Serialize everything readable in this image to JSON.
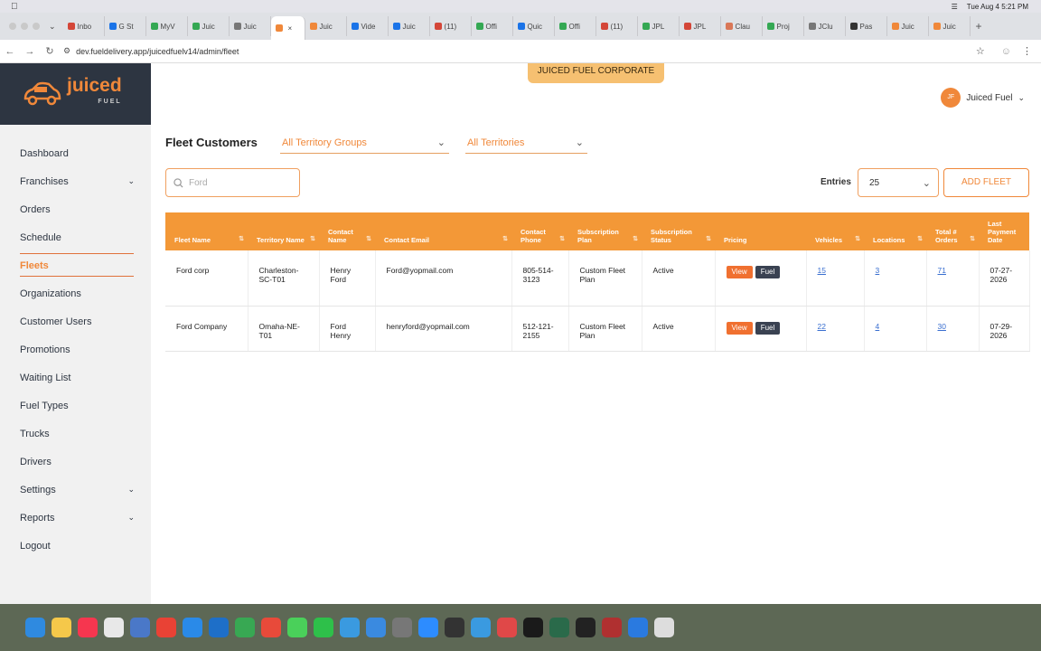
{
  "menubar": {
    "clock": "Tue Aug 4  5:21 PM"
  },
  "browser": {
    "tabs": [
      {
        "label": "Inbo",
        "color": "#d44638"
      },
      {
        "label": "G St",
        "color": "#1a73e8"
      },
      {
        "label": "MyV",
        "color": "#34a853"
      },
      {
        "label": "Juic",
        "color": "#34a853"
      },
      {
        "label": "Juic",
        "color": "#777"
      },
      {
        "label": "",
        "color": "#f0883a",
        "active": true
      },
      {
        "label": "Juic",
        "color": "#f0883a"
      },
      {
        "label": "Vide",
        "color": "#1a73e8"
      },
      {
        "label": "Juic",
        "color": "#1a73e8"
      },
      {
        "label": "(11)",
        "color": "#d44638"
      },
      {
        "label": "Offi",
        "color": "#34a853"
      },
      {
        "label": "Quic",
        "color": "#1a73e8"
      },
      {
        "label": "Offi",
        "color": "#34a853"
      },
      {
        "label": "(11)",
        "color": "#d44638"
      },
      {
        "label": "JPL",
        "color": "#34a853"
      },
      {
        "label": "JPL",
        "color": "#d44638"
      },
      {
        "label": "Clau",
        "color": "#d97757"
      },
      {
        "label": "Proj",
        "color": "#34a853"
      },
      {
        "label": "JClu",
        "color": "#777"
      },
      {
        "label": "Pas",
        "color": "#333"
      },
      {
        "label": "Juic",
        "color": "#f0883a"
      },
      {
        "label": "Juic",
        "color": "#f0883a"
      }
    ],
    "url": "dev.fueldelivery.app/juicedfuelv14/admin/fleet"
  },
  "sidebar": {
    "brand": "juiced",
    "brand_sub": "FUEL",
    "items": [
      {
        "label": "Dashboard",
        "chevron": false
      },
      {
        "label": "Franchises",
        "chevron": true
      },
      {
        "label": "Orders",
        "chevron": false
      },
      {
        "label": "Schedule",
        "chevron": false
      },
      {
        "label": "Fleets",
        "chevron": false,
        "active": true
      },
      {
        "label": "Organizations",
        "chevron": false
      },
      {
        "label": "Customer Users",
        "chevron": false
      },
      {
        "label": "Promotions",
        "chevron": false
      },
      {
        "label": "Waiting List",
        "chevron": false
      },
      {
        "label": "Fuel Types",
        "chevron": false
      },
      {
        "label": "Trucks",
        "chevron": false
      },
      {
        "label": "Drivers",
        "chevron": false
      },
      {
        "label": "Settings",
        "chevron": true
      },
      {
        "label": "Reports",
        "chevron": true
      },
      {
        "label": "Logout",
        "chevron": false
      }
    ]
  },
  "header": {
    "corporate_badge": "JUICED FUEL CORPORATE",
    "user_initials": "JF",
    "user_name": "Juiced Fuel"
  },
  "main": {
    "title": "Fleet Customers",
    "territory_groups": "All Territory Groups",
    "territories": "All Territories",
    "search_placeholder": "Ford",
    "entries_label": "Entries",
    "entries_value": "25",
    "add_button": "ADD FLEET"
  },
  "table": {
    "columns": [
      "Fleet Name",
      "Territory Name",
      "Contact Name",
      "Contact Email",
      "Contact Phone",
      "Subscription Plan",
      "Subscription Status",
      "Pricing",
      "Vehicles",
      "Locations",
      "Total # Orders",
      "Last Payment Date"
    ],
    "rows": [
      {
        "fleet": "Ford corp",
        "territory": "Charleston-SC-T01",
        "contact": "Henry Ford",
        "email": "Ford@yopmail.com",
        "phone": "805-514-3123",
        "plan": "Custom Fleet Plan",
        "status": "Active",
        "view": "View",
        "fuel": "Fuel",
        "vehicles": "15",
        "locations": "3",
        "orders": "71",
        "payment": "07-27-2026"
      },
      {
        "fleet": "Ford Company",
        "territory": "Omaha-NE-T01",
        "contact": "Ford Henry",
        "email": "henryford@yopmail.com",
        "phone": "512-121-2155",
        "plan": "Custom Fleet Plan",
        "status": "Active",
        "view": "View",
        "fuel": "Fuel",
        "vehicles": "22",
        "locations": "4",
        "orders": "30",
        "payment": "07-29-2026"
      }
    ]
  }
}
